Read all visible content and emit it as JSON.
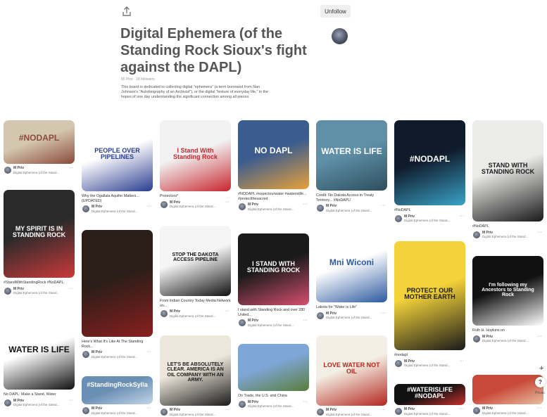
{
  "header": {
    "share_icon": "share-icon",
    "unfollow_label": "Unfollow",
    "title": "Digital Ephemera (of the Standing Rock Sioux's fight against the DAPL)",
    "stats": "85 Pins · 18 followers",
    "description": "This board is dedicated to collecting digital \"ephemera\" (a term borrowed from Nan Johnson's \"Autobiography of an Archivist\"), or the digital \"texture of everyday life,\" in the hopes of one day understanding the significant connection among all pieces."
  },
  "colors": {
    "accent": "#e60023",
    "title": "#555555",
    "button_bg": "#efefef"
  },
  "pins": [
    {
      "id": "p1",
      "title": "",
      "overlay": "#NODAPL",
      "user": "M Priv",
      "board": "Digital Ephemera (of the Stand...",
      "colors": [
        "#d4c7b0",
        "#8b4a3a"
      ]
    },
    {
      "id": "p2",
      "title": "Why the Ogallala Aquifer Matters...(UPDATED)",
      "overlay": "PEOPLE OVER PIPELINES",
      "user": "M Priv",
      "board": "Digital Ephemera (of the Stand...",
      "colors": [
        "#ffffff",
        "#2a3d8f"
      ]
    },
    {
      "id": "p3",
      "title": "Protectors*",
      "overlay": "I Stand With Standing Rock",
      "user": "M Priv",
      "board": "Digital Ephemera (of the Stand...",
      "colors": [
        "#f2f2f2",
        "#c7262e"
      ]
    },
    {
      "id": "p4",
      "title": "#NODAPL #expectourwater #waterislife... #protectthesacred",
      "overlay": "NO DAPL",
      "user": "M Priv",
      "board": "Digital Ephemera (of the Stand...",
      "colors": [
        "#3b5c8f",
        "#e8a13a"
      ]
    },
    {
      "id": "p5",
      "title": "Credit: No Dakota Access in Treaty Territory... #NoDAPL!",
      "overlay": "WATER IS LIFE",
      "user": "M Priv",
      "board": "Digital Ephemera (of the Stand...",
      "colors": [
        "#5f90a8",
        "#2d4f5e"
      ]
    },
    {
      "id": "p6",
      "title": "#NoDAPL",
      "overlay": "#NODAPL",
      "user": "M Priv",
      "board": "Digital Ephemera (of the Stand...",
      "colors": [
        "#0f1a2a",
        "#3ba3c8"
      ]
    },
    {
      "id": "p7",
      "title": "#NoDAPL",
      "overlay": "STAND WITH STANDING ROCK",
      "user": "M Priv",
      "board": "Digital Ephemera (of the Stand...",
      "colors": [
        "#ececea",
        "#1a1a1a"
      ]
    },
    {
      "id": "p8",
      "title": "#StandWithStandingRock #NoDAPL",
      "overlay": "MY SPIRIT IS IN STANDING ROCK",
      "user": "M Priv",
      "board": "Digital Ephemera (of the Stand...",
      "colors": [
        "#2a2a2a",
        "#cc3a3a"
      ]
    },
    {
      "id": "p9",
      "title": "Here's What It's Like At The Standing Rock...",
      "overlay": "",
      "user": "M Priv",
      "board": "Digital Ephemera (of the Stand...",
      "colors": [
        "#2b1e18",
        "#8a1f1f"
      ]
    },
    {
      "id": "p10",
      "title": "From Indian Country Today Media Network on...",
      "overlay": "STOP THE DAKOTA ACCESS PIPELINE",
      "user": "M Priv",
      "board": "Digital Ephemera (of the Stand...",
      "colors": [
        "#f5f5f5",
        "#111111"
      ]
    },
    {
      "id": "p11",
      "title": "I stand with Standing Rock and over 280 United...",
      "overlay": "I STAND WITH STANDING ROCK",
      "user": "M Priv",
      "board": "Digital Ephemera (of the Stand...",
      "colors": [
        "#1a1a1a",
        "#d64f6f"
      ]
    },
    {
      "id": "p12",
      "title": "Lakota for \"Water is Life\"",
      "overlay": "Mni Wiconi",
      "user": "M Priv",
      "board": "Digital Ephemera (of the Stand...",
      "colors": [
        "#ffffff",
        "#2c5aa0"
      ]
    },
    {
      "id": "p13",
      "title": "#nodapl",
      "overlay": "PROTECT OUR MOTHER EARTH",
      "user": "M Priv",
      "board": "Digital Ephemera (of the Stand...",
      "colors": [
        "#f4d33a",
        "#1a1a1a"
      ]
    },
    {
      "id": "p14",
      "title": "Ruth H. Hopkins on",
      "overlay": "I'm following my Ancestors to Standing Rock",
      "user": "M Priv",
      "board": "Digital Ephemera (of the Stand...",
      "colors": [
        "#111111",
        "#ffffff"
      ]
    },
    {
      "id": "p15",
      "title": "No DAPL: Make a Stand, Water",
      "overlay": "WATER IS LIFE",
      "user": "M Priv",
      "board": "Digital Ephemera (of the Stand...",
      "colors": [
        "#ffffff",
        "#111111"
      ]
    },
    {
      "id": "p16",
      "title": "",
      "overlay": "#StandingRockSylla",
      "user": "M Priv",
      "board": "Digital Ephemera (of the Stand...",
      "colors": [
        "#6a8fb5",
        "#c4d6e6"
      ]
    },
    {
      "id": "p17",
      "title": "",
      "overlay": "LET'S BE ABSOLUTELY CLEAR. AMERICA IS AN OIL COMPANY WITH AN ARMY.",
      "user": "M Priv",
      "board": "Digital Ephemera (of the Stand...",
      "colors": [
        "#ede6da",
        "#1a1a1a"
      ]
    },
    {
      "id": "p18",
      "title": "On Trade, the U.S. and China",
      "overlay": "",
      "user": "M Priv",
      "board": "Digital Ephemera (of the Stand...",
      "colors": [
        "#7ea6d6",
        "#5a7d3a"
      ]
    },
    {
      "id": "p19",
      "title": "",
      "overlay": "LOVE WATER NOT OIL",
      "user": "M Priv",
      "board": "Digital Ephemera (of the Stand...",
      "colors": [
        "#f4efe4",
        "#b3261e"
      ]
    },
    {
      "id": "p20",
      "title": "",
      "overlay": "#WATERISLIFE #NODAPL",
      "user": "M Priv",
      "board": "Digital Ephemera (of the Stand...",
      "colors": [
        "#111111",
        "#c8302c"
      ]
    },
    {
      "id": "p21",
      "title": "",
      "overlay": "",
      "user": "M Priv",
      "board": "Digital Ephemera (of the Stand...",
      "colors": [
        "#c94a3a",
        "#e8c0a0"
      ]
    }
  ],
  "fab": {
    "plus": "+",
    "help": "?",
    "privacy": "Privac"
  }
}
